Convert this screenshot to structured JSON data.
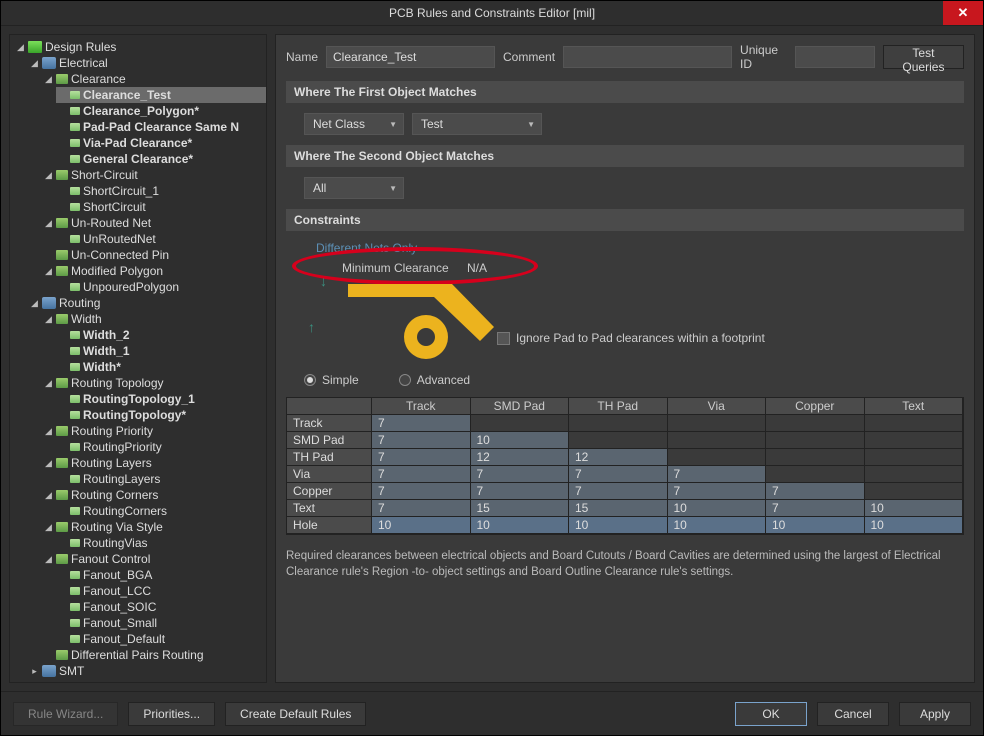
{
  "window": {
    "title": "PCB Rules and Constraints Editor [mil]"
  },
  "tree": {
    "root": "Design Rules",
    "electrical": "Electrical",
    "clearance": "Clearance",
    "clr_items": [
      "Clearance_Test",
      "Clearance_Polygon*",
      "Pad-Pad Clearance Same N",
      "Via-Pad Clearance*",
      "General Clearance*"
    ],
    "short": "Short-Circuit",
    "short_items": [
      "ShortCircuit_1",
      "ShortCircuit"
    ],
    "unrouted": "Un-Routed Net",
    "unrouted_items": [
      "UnRoutedNet"
    ],
    "unconnected": "Un-Connected Pin",
    "modpoly": "Modified Polygon",
    "modpoly_items": [
      "UnpouredPolygon"
    ],
    "routing": "Routing",
    "width": "Width",
    "width_items": [
      "Width_2",
      "Width_1",
      "Width*"
    ],
    "rtopo": "Routing Topology",
    "rtopo_items": [
      "RoutingTopology_1",
      "RoutingTopology*"
    ],
    "rprio": "Routing Priority",
    "rprio_items": [
      "RoutingPriority"
    ],
    "rlayers": "Routing Layers",
    "rlayers_items": [
      "RoutingLayers"
    ],
    "rcorners": "Routing Corners",
    "rcorners_items": [
      "RoutingCorners"
    ],
    "rvia": "Routing Via Style",
    "rvia_items": [
      "RoutingVias"
    ],
    "fanout": "Fanout Control",
    "fanout_items": [
      "Fanout_BGA",
      "Fanout_LCC",
      "Fanout_SOIC",
      "Fanout_Small",
      "Fanout_Default"
    ],
    "diffpair": "Differential Pairs Routing",
    "smt": "SMT"
  },
  "form": {
    "name_label": "Name",
    "name_value": "Clearance_Test",
    "comment_label": "Comment",
    "comment_value": "",
    "uniqueid_label": "Unique ID",
    "uniqueid_value": "",
    "test_queries": "Test Queries"
  },
  "sections": {
    "first": "Where The First Object Matches",
    "second": "Where The Second Object Matches",
    "constraints": "Constraints"
  },
  "first_obj": {
    "type": "Net Class",
    "value": "Test"
  },
  "second_obj": {
    "type": "All"
  },
  "constraints": {
    "diff_nets": "Different Nets Only",
    "min_clr_label": "Minimum Clearance",
    "min_clr_value": "N/A",
    "ignore_pad": "Ignore Pad to Pad clearances within a footprint",
    "mode_simple": "Simple",
    "mode_advanced": "Advanced"
  },
  "grid": {
    "cols": [
      "Track",
      "SMD Pad",
      "TH Pad",
      "Via",
      "Copper",
      "Text"
    ],
    "rows": [
      {
        "name": "Track",
        "vals": [
          "7",
          "",
          "",
          "",
          "",
          ""
        ]
      },
      {
        "name": "SMD Pad",
        "vals": [
          "7",
          "10",
          "",
          "",
          "",
          ""
        ]
      },
      {
        "name": "TH Pad",
        "vals": [
          "7",
          "12",
          "12",
          "",
          "",
          ""
        ]
      },
      {
        "name": "Via",
        "vals": [
          "7",
          "7",
          "7",
          "7",
          "",
          ""
        ]
      },
      {
        "name": "Copper",
        "vals": [
          "7",
          "7",
          "7",
          "7",
          "7",
          ""
        ]
      },
      {
        "name": "Text",
        "vals": [
          "7",
          "15",
          "15",
          "10",
          "7",
          "10"
        ]
      },
      {
        "name": "Hole",
        "vals": [
          "10",
          "10",
          "10",
          "10",
          "10",
          "10"
        ],
        "hole": true
      }
    ]
  },
  "note": "Required clearances between electrical objects and Board Cutouts / Board Cavities are determined using the largest of Electrical Clearance rule's Region -to- object settings and Board Outline Clearance rule's settings.",
  "footer": {
    "rule_wizard": "Rule Wizard...",
    "priorities": "Priorities...",
    "create_default": "Create Default Rules",
    "ok": "OK",
    "cancel": "Cancel",
    "apply": "Apply"
  }
}
